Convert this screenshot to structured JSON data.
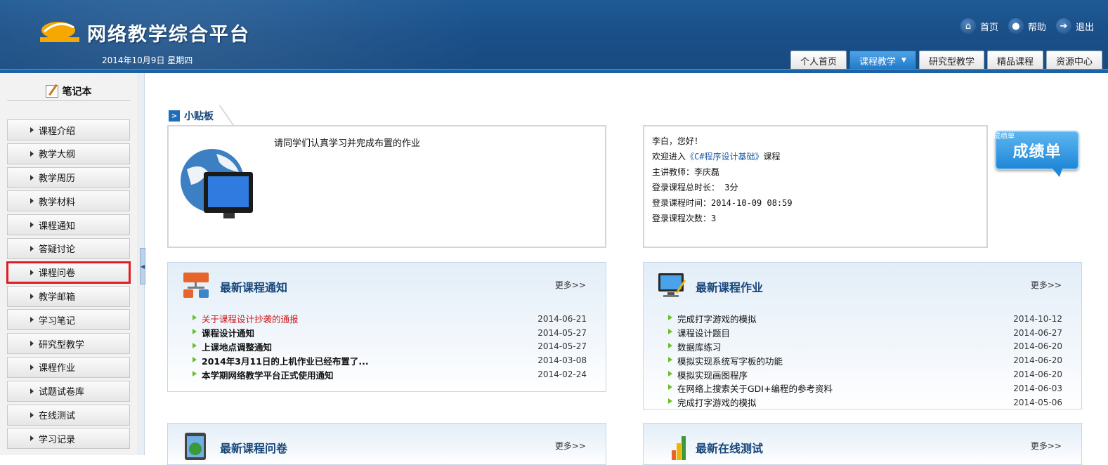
{
  "header": {
    "title": "网络教学综合平台",
    "date": "2014年10月9日 星期四",
    "links": [
      {
        "label": "首页",
        "icon": "home-icon"
      },
      {
        "label": "帮助",
        "icon": "help-bulb-icon"
      },
      {
        "label": "退出",
        "icon": "exit-icon"
      }
    ],
    "tabs": [
      {
        "label": "个人首页"
      },
      {
        "label": "课程教学"
      },
      {
        "label": "研究型教学"
      },
      {
        "label": "精品课程"
      },
      {
        "label": "资源中心"
      }
    ],
    "active_tab": "课程教学"
  },
  "sidebar": {
    "notebook_label": "笔记本",
    "items": [
      {
        "label": "课程介绍"
      },
      {
        "label": "教学大纲"
      },
      {
        "label": "教学周历"
      },
      {
        "label": "教学材料"
      },
      {
        "label": "课程通知"
      },
      {
        "label": "答疑讨论"
      },
      {
        "label": "课程问卷"
      },
      {
        "label": "教学邮箱"
      },
      {
        "label": "学习笔记"
      },
      {
        "label": "研究型教学"
      },
      {
        "label": "课程作业"
      },
      {
        "label": "试题试卷库"
      },
      {
        "label": "在线测试"
      },
      {
        "label": "学习记录"
      }
    ],
    "highlighted_item": "课程问卷"
  },
  "tips": {
    "title": "小贴板",
    "message": "请同学们认真学习并完成布置的作业"
  },
  "welcome": {
    "greeting": "李白，您好！",
    "enter_prefix": "欢迎进入",
    "course_name": "《C#程序设计基础》",
    "enter_suffix": "课程",
    "teacher": "主讲教师：李庆磊",
    "total_time": "登录课程总时长： 3分",
    "login_time": "登录课程时间：2014-10-09 08:59",
    "login_count": "登录课程次数：3",
    "grade_button": "成绩单",
    "grade_small": "成绩单"
  },
  "notices": {
    "title": "最新课程通知",
    "more": "更多>>",
    "items": [
      {
        "title": "关于课程设计抄袭的通报",
        "date": "2014-06-21"
      },
      {
        "title": "课程设计通知",
        "date": "2014-05-27"
      },
      {
        "title": "上课地点调整通知",
        "date": "2014-05-27"
      },
      {
        "title": "2014年3月11日的上机作业已经布置了...",
        "date": "2014-03-08"
      },
      {
        "title": "本学期网络教学平台正式使用通知",
        "date": "2014-02-24"
      }
    ]
  },
  "homework": {
    "title": "最新课程作业",
    "more": "更多>>",
    "items": [
      {
        "title": "完成打字游戏的模拟",
        "date": "2014-10-12"
      },
      {
        "title": "课程设计题目",
        "date": "2014-06-27"
      },
      {
        "title": "数据库练习",
        "date": "2014-06-20"
      },
      {
        "title": "模拟实现系统写字板的功能",
        "date": "2014-06-20"
      },
      {
        "title": "模拟实现画图程序",
        "date": "2014-06-20"
      },
      {
        "title": "在网络上搜索关于GDI+编程的参考资料",
        "date": "2014-06-03"
      },
      {
        "title": "完成打字游戏的模拟",
        "date": "2014-05-06"
      }
    ]
  },
  "surveys": {
    "title": "最新课程问卷",
    "more": "更多>>"
  },
  "tests": {
    "title": "最新在线测试",
    "more": "更多>>"
  },
  "colors": {
    "header_bg": "#1a4f88",
    "active_tab": "#1f78c9",
    "panel_title": "#17467a",
    "alert_red": "#c9191d",
    "bullet_green": "#6bbf2c"
  }
}
